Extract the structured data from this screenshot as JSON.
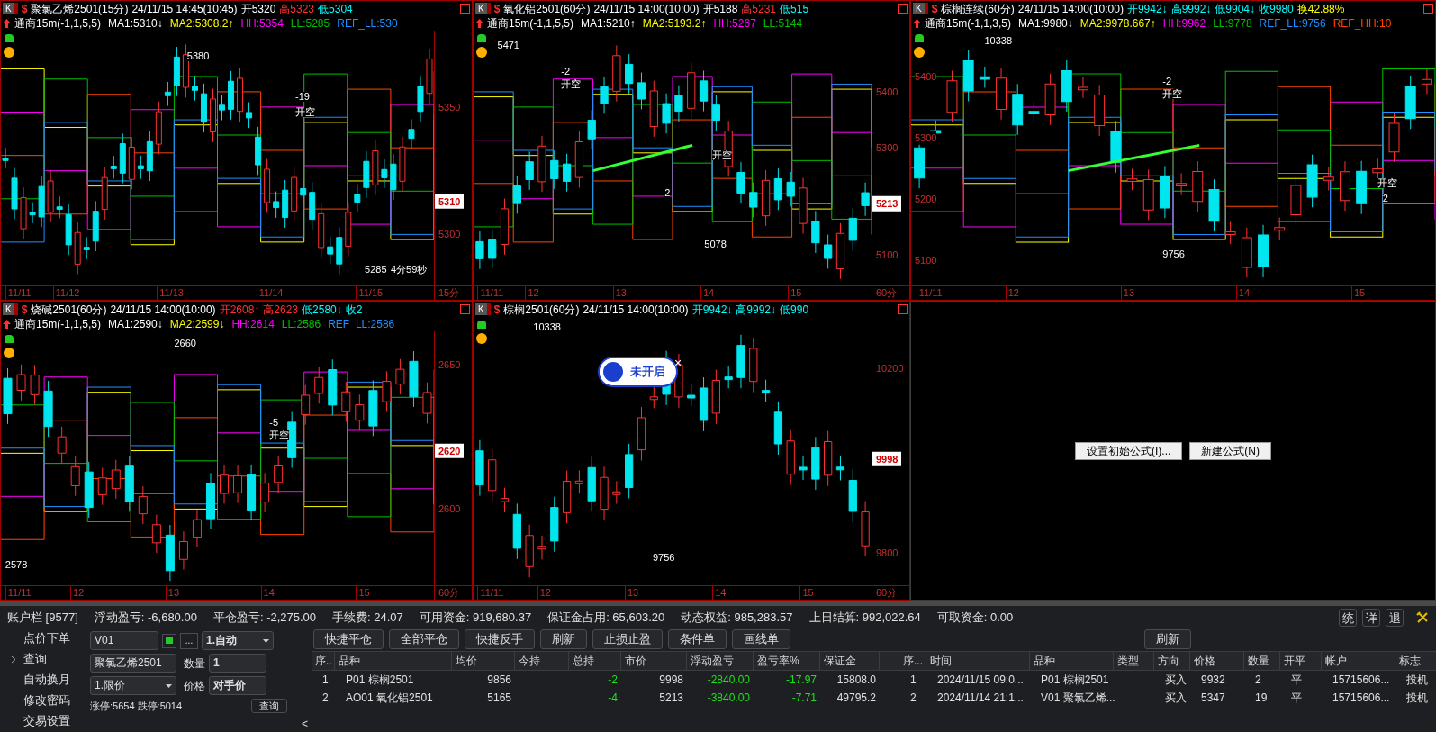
{
  "charts": [
    {
      "chart_button": "K",
      "symbol_mark": "$",
      "title": "聚氯乙烯2501(15分)",
      "time": "24/11/15 14:45(10:45)",
      "quotes": [
        {
          "text": "开5320",
          "color": "#ffffff"
        },
        {
          "text": "高5323",
          "color": "#ff3030"
        },
        {
          "text": "低5304",
          "color": "#00ffff"
        }
      ],
      "formula": "通商15m(-1,1,5,5)",
      "indicators": [
        {
          "text": "MA1:5310↓",
          "color": "#ffffff"
        },
        {
          "text": "MA2:5308.2↑",
          "color": "#ffff00"
        },
        {
          "text": "HH:5354",
          "color": "#ff00ff"
        },
        {
          "text": "LL:5285",
          "color": "#00c000"
        },
        {
          "text": "REF_LL:530",
          "color": "#1e90ff"
        }
      ],
      "yticks": [
        "5350",
        "5300"
      ],
      "price_tag": "5310",
      "xticks": [
        "11/11",
        "11/12",
        "11/13",
        "11/14",
        "11/15"
      ],
      "period": "15分",
      "annotations": [
        "5380",
        "-19",
        "开空",
        "5285",
        "4分59秒"
      ]
    },
    {
      "chart_button": "K",
      "symbol_mark": "$",
      "title": "氧化铝2501(60分)",
      "time": "24/11/15 14:00(10:00)",
      "quotes": [
        {
          "text": "开5188",
          "color": "#ffffff"
        },
        {
          "text": "高5231",
          "color": "#ff3030"
        },
        {
          "text": "低515",
          "color": "#00ffff"
        }
      ],
      "formula": "通商15m(-1,1,5,5)",
      "indicators": [
        {
          "text": "MA1:5210↑",
          "color": "#ffffff"
        },
        {
          "text": "MA2:5193.2↑",
          "color": "#ffff00"
        },
        {
          "text": "HH:5267",
          "color": "#ff00ff"
        },
        {
          "text": "LL:5144",
          "color": "#00c000"
        }
      ],
      "yticks": [
        "5400",
        "5300",
        "5100"
      ],
      "price_tag": "5213",
      "xticks": [
        "11/11",
        "12",
        "13",
        "14",
        "15"
      ],
      "period": "60分",
      "annotations": [
        "5471",
        "-2",
        "开空",
        "开空",
        "2",
        "5078"
      ]
    },
    {
      "chart_button": "K",
      "symbol_mark": "$",
      "title": "棕榈连续(60分)",
      "time": "24/11/15 14:00(10:00)",
      "quotes": [
        {
          "text": "开9942↓",
          "color": "#00ffff"
        },
        {
          "text": "高9992↓",
          "color": "#00ffff"
        },
        {
          "text": "低9904↓",
          "color": "#00ffff"
        },
        {
          "text": "收9980",
          "color": "#00ffff"
        },
        {
          "text": "换42.88%",
          "color": "#ffff00"
        }
      ],
      "formula": "通商15m(-1,1,3,5)",
      "indicators": [
        {
          "text": "MA1:9980↓",
          "color": "#ffffff"
        },
        {
          "text": "MA2:9978.667↑",
          "color": "#ffff00"
        },
        {
          "text": "HH:9962",
          "color": "#ff00ff"
        },
        {
          "text": "LL:9778",
          "color": "#00c000"
        },
        {
          "text": "REF_LL:9756",
          "color": "#1e90ff"
        },
        {
          "text": "REF_HH:10",
          "color": "#ff4500"
        }
      ],
      "yticks": [
        "5400",
        "5300",
        "5200",
        "5100"
      ],
      "xticks": [
        "11/11",
        "12",
        "13",
        "14",
        "15"
      ],
      "annotations": [
        "10338",
        "-2",
        "开空",
        "开空",
        "2",
        "9756"
      ]
    },
    {
      "chart_button": "K",
      "symbol_mark": "$",
      "title": "烧碱2501(60分)",
      "time": "24/11/15 14:00(10:00)",
      "quotes": [
        {
          "text": "开2608↑",
          "color": "#ff3030"
        },
        {
          "text": "高2623",
          "color": "#ff3030"
        },
        {
          "text": "低2580↓",
          "color": "#00ffff"
        },
        {
          "text": "收2",
          "color": "#00ffff"
        }
      ],
      "formula": "通商15m(-1,1,5,5)",
      "indicators": [
        {
          "text": "MA1:2590↓",
          "color": "#ffffff"
        },
        {
          "text": "MA2:2599↓",
          "color": "#ffff00"
        },
        {
          "text": "HH:2614",
          "color": "#ff00ff"
        },
        {
          "text": "LL:2586",
          "color": "#00c000"
        },
        {
          "text": "REF_LL:2586",
          "color": "#1e90ff"
        }
      ],
      "yticks": [
        "2650",
        "2600"
      ],
      "price_tag": "2620",
      "xticks": [
        "11/11",
        "12",
        "13",
        "14",
        "15"
      ],
      "period": "60分",
      "annotations": [
        "2660",
        "-5",
        "开空",
        "2578"
      ]
    },
    {
      "chart_button": "K",
      "symbol_mark": "$",
      "title": "棕榈2501(60分)",
      "time": "24/11/15 14:00(10:00)",
      "quotes": [
        {
          "text": "开9942↓",
          "color": "#00ffff"
        },
        {
          "text": "高9992↓",
          "color": "#00ffff"
        },
        {
          "text": "低990",
          "color": "#00ffff"
        }
      ],
      "yticks": [
        "10200",
        "9800"
      ],
      "price_tag": "9998",
      "xticks": [
        "11/11",
        "12",
        "13",
        "14",
        "15"
      ],
      "period": "60分",
      "annotations": [
        "10338",
        "9756"
      ],
      "popup": {
        "label": "未开启",
        "close": "×"
      }
    }
  ],
  "empty_panel": {
    "buttons": [
      "设置初始公式(I)...",
      "新建公式(N)"
    ]
  },
  "account_bar": {
    "items": [
      "账户栏 [9577]",
      "浮动盈亏: -6,680.00",
      "平仓盈亏: -2,275.00",
      "手续费: 24.07",
      "可用资金: 919,680.37",
      "保证金占用: 65,603.20",
      "动态权益: 985,283.57",
      "上日结算: 992,022.64",
      "可取资金: 0.00"
    ],
    "buttons": [
      "统",
      "详",
      "退"
    ]
  },
  "menu": [
    {
      "label": "点价下单",
      "expandable": false
    },
    {
      "label": "查询",
      "expandable": true
    },
    {
      "label": "自动换月",
      "expandable": false
    },
    {
      "label": "修改密码",
      "expandable": false
    },
    {
      "label": "交易设置",
      "expandable": false
    }
  ],
  "order_form": {
    "account": "V01",
    "more": "...",
    "mode": "1.自动",
    "symbol": "聚氯乙烯2501",
    "qty_label": "数量",
    "qty": "1",
    "order_type": "1.限价",
    "price_label": "价格",
    "price": "对手价",
    "limits": "涨停:5654 跌停:5014",
    "query": "查询",
    "collapse": "<"
  },
  "positions": {
    "toolbar": [
      "快捷平仓",
      "全部平仓",
      "快捷反手",
      "刷新",
      "止损止盈",
      "条件单",
      "画线单"
    ],
    "columns": [
      "序..",
      "品种",
      "均价",
      "今持",
      "总持",
      "市价",
      "浮动盈亏",
      "盈亏率%",
      "保证金"
    ],
    "rows": [
      [
        "1",
        "P01 棕榈2501",
        "9856",
        null,
        "-2",
        "9998",
        "-2840.00",
        "-17.97",
        "15808.0"
      ],
      [
        "2",
        "AO01 氧化铝2501",
        "5165",
        null,
        "-4",
        "5213",
        "-3840.00",
        "-7.71",
        "49795.2"
      ]
    ]
  },
  "orders": {
    "refresh": "刷新",
    "columns": [
      "序...",
      "时间",
      "品种",
      "类型",
      "方向",
      "价格",
      "数量",
      "开平",
      "帐户",
      "标志"
    ],
    "rows": [
      [
        "1",
        "2024/11/15 09:0...",
        "P01 棕榈2501",
        null,
        "买入",
        "9932",
        "2",
        "平",
        "15715606...",
        "投机"
      ],
      [
        "2",
        "2024/11/14 21:1...",
        "V01 聚氯乙烯...",
        null,
        "买入",
        "5347",
        "19",
        "平",
        "15715606...",
        "投机"
      ]
    ]
  }
}
